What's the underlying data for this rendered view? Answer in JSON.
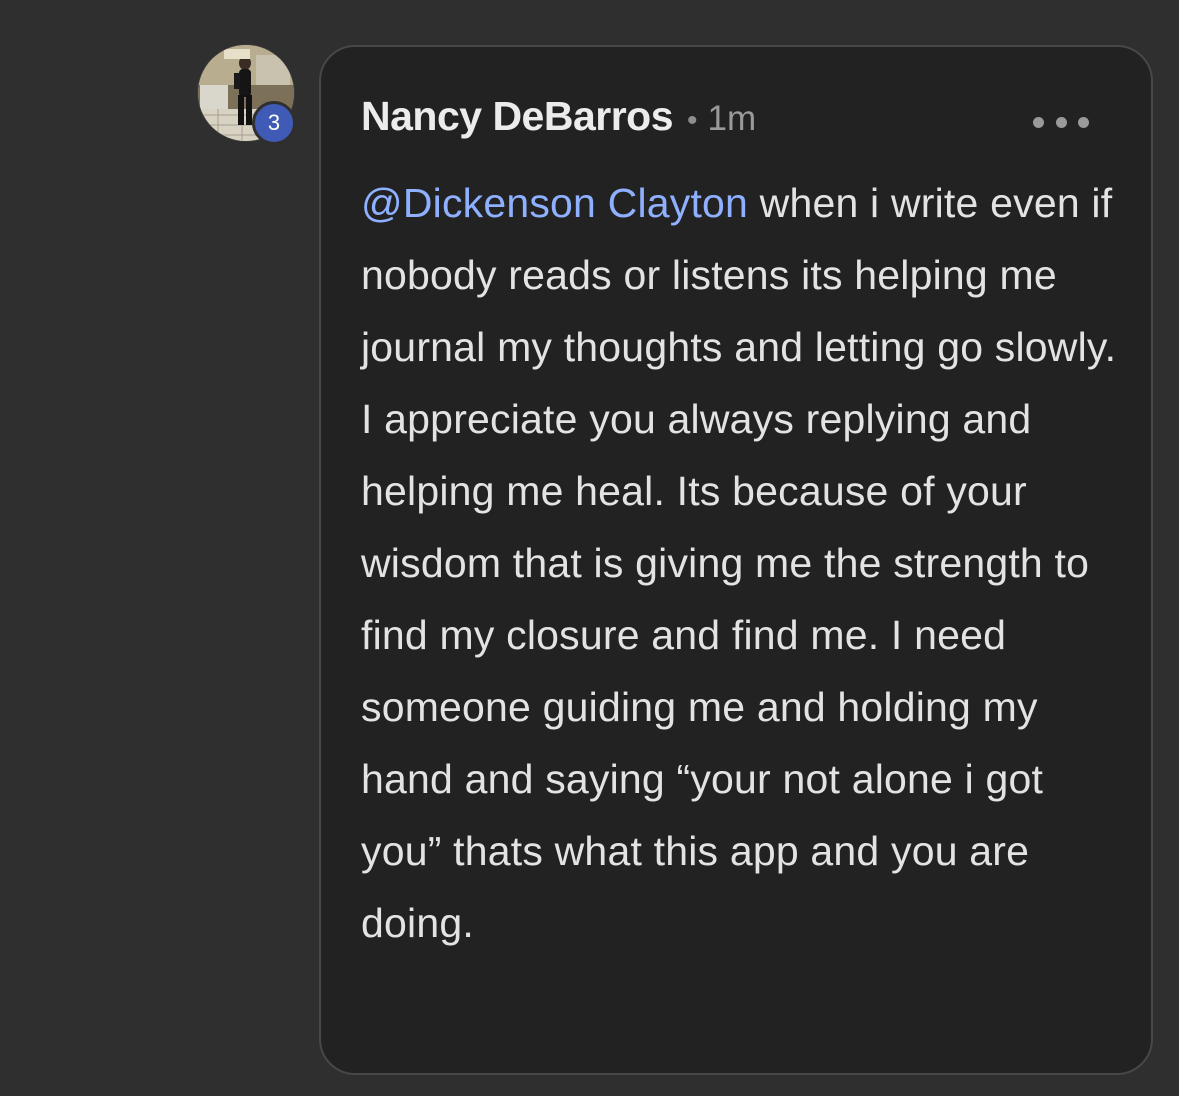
{
  "comment": {
    "author": "Nancy DeBarros",
    "separator": "•",
    "time": "1m",
    "level_badge": "3",
    "mention": "@Dickenson Clayton",
    "body": " when i write even if nobody reads or listens its helping me journal my thoughts and letting go slowly. I appreciate you always replying and helping me heal. Its because of your wisdom that is giving me the strength to find my closure and find me. I need someone guiding me and holding my hand and saying “your not alone i got you” thats what this app and you are doing.",
    "more_icon": "more-horizontal-icon"
  },
  "colors": {
    "background": "#2f2f2f",
    "bubble": "#222222",
    "bubble_border": "#474747",
    "mention": "#8fb0ff",
    "badge": "#3f5bb5"
  }
}
